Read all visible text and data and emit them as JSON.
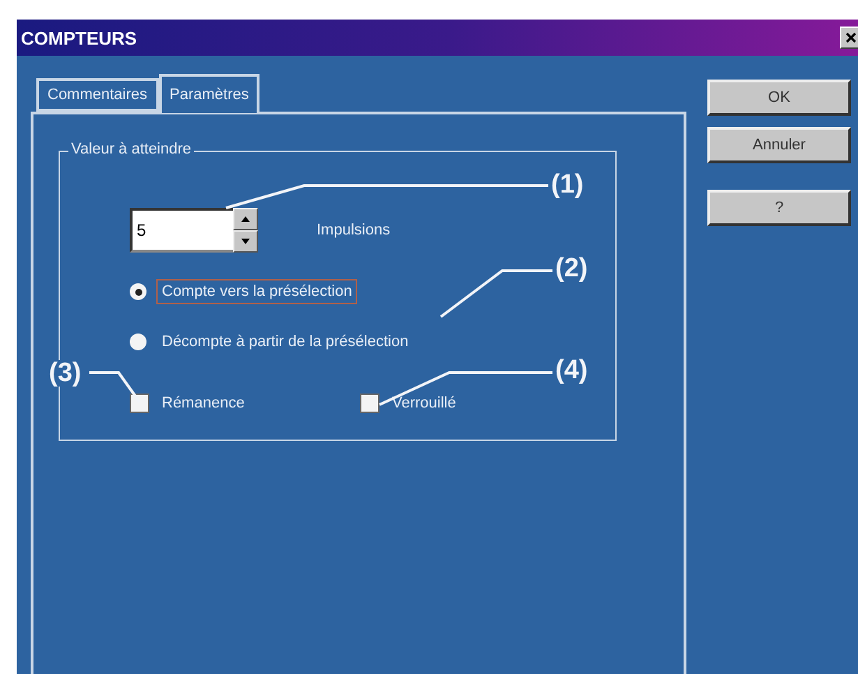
{
  "window": {
    "title": "COMPTEURS"
  },
  "tabs": [
    {
      "label": "Commentaires",
      "selected": false
    },
    {
      "label": "Paramètres",
      "selected": true
    }
  ],
  "group": {
    "legend": "Valeur à atteindre",
    "spin": {
      "value": "5",
      "unit": "Impulsions"
    },
    "options": [
      {
        "label": "Compte vers la présélection",
        "selected": true,
        "focused": true
      },
      {
        "label": "Décompte à partir de la présélection",
        "selected": false,
        "focused": false
      }
    ],
    "checkboxes": [
      {
        "label": "Rémanence",
        "checked": false
      },
      {
        "label": "Verrouillé",
        "checked": false
      }
    ]
  },
  "buttons": [
    "OK",
    "Annuler",
    "?"
  ],
  "callouts": [
    "(1)",
    "(2)",
    "(3)",
    "(4)"
  ]
}
